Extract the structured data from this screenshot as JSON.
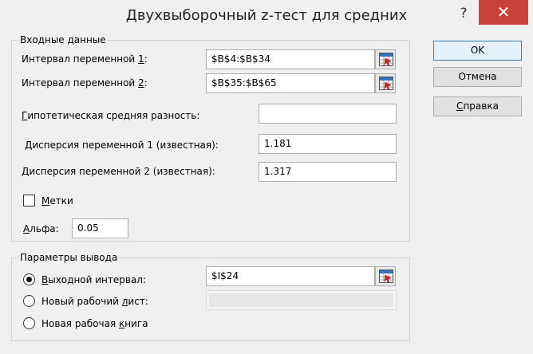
{
  "window": {
    "title": "Двухвыборочный z-тест для средних",
    "help_glyph": "?",
    "close_glyph": "✕"
  },
  "input_group": {
    "label": "Входные данные",
    "range1_label": "Интервал переменной 1:",
    "range1_value": "$B$4:$B$34",
    "range2_label": "Интервал переменной 2:",
    "range2_value": "$B$35:$B$65",
    "hyp_diff_label": "Гипотетическая средняя разность:",
    "hyp_diff_value": "",
    "var1_label": "Дисперсия переменной 1 (известная):",
    "var1_value": "1.181",
    "var2_label": "Дисперсия переменной 2 (известная):",
    "var2_value": "1.317",
    "labels_checkbox_label": "Метки",
    "labels_checked": false,
    "alpha_label": "Альфа:",
    "alpha_value": "0.05"
  },
  "output_group": {
    "label": "Параметры вывода",
    "output_range_label": "Выходной интервал:",
    "output_range_value": "$I$24",
    "new_sheet_label": "Новый рабочий лист:",
    "new_sheet_value": "",
    "new_workbook_label": "Новая рабочая книга",
    "selected": "output_range"
  },
  "buttons": {
    "ok": "OK",
    "cancel": "Отмена",
    "help": "Справка"
  },
  "colors": {
    "close_button": "#c7433a",
    "default_button_border": "#3c7fb1"
  }
}
